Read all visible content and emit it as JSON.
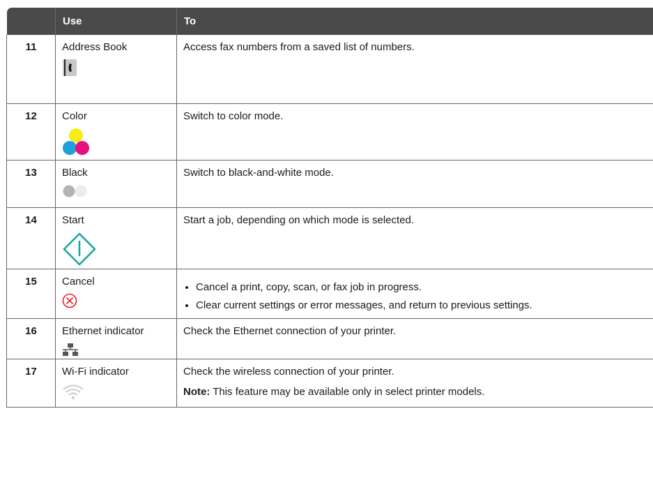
{
  "header": {
    "col_blank": "",
    "col_use": "Use",
    "col_to": "To"
  },
  "rows": [
    {
      "num": "11",
      "use": "Address Book",
      "icon": "address-book-icon",
      "to": "Access fax numbers from a saved list of numbers."
    },
    {
      "num": "12",
      "use": "Color",
      "icon": "color-icon",
      "to": "Switch to color mode."
    },
    {
      "num": "13",
      "use": "Black",
      "icon": "black-icon",
      "to": "Switch to black-and-white mode."
    },
    {
      "num": "14",
      "use": "Start",
      "icon": "start-icon",
      "to": "Start a job, depending on which mode is selected."
    },
    {
      "num": "15",
      "use": "Cancel",
      "icon": "cancel-icon",
      "to_bullets": [
        "Cancel a print, copy, scan, or fax job in progress.",
        "Clear current settings or error messages, and return to previous settings."
      ]
    },
    {
      "num": "16",
      "use": "Ethernet indicator",
      "icon": "ethernet-icon",
      "to": "Check the Ethernet connection of your printer."
    },
    {
      "num": "17",
      "use": "Wi-Fi indicator",
      "icon": "wifi-icon",
      "to": "Check the wireless connection of your printer.",
      "note_label": "Note:",
      "note_text": " This feature may be available only in select printer models."
    }
  ],
  "colors": {
    "header_bg": "#4a4a4a",
    "start_teal": "#1aa79a",
    "cancel_red": "#e0202a",
    "cyan": "#1da1d9",
    "magenta": "#e5127d",
    "yellow": "#f7ec1a"
  }
}
